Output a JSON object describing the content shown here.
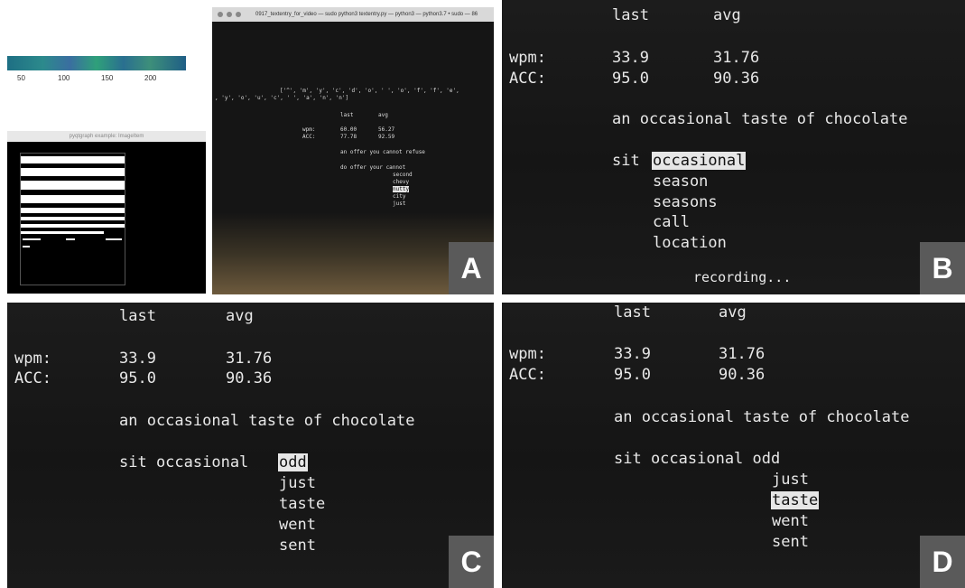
{
  "panel_a": {
    "strip_ticks": [
      "50",
      "100",
      "150",
      "200"
    ],
    "pygraph_title": "pyqtgraph example: ImageItem",
    "terminal_title": "0917_textentry_for_video — sudo python3 textentry.py — python3 — python3.7 • sudo — 86",
    "char_list_line1": "['^', 'm', 'y', 'c', 'd', 'o', ' ', 'o', 'f', 'f', 'e',",
    "char_list_line2": ", 'y', 'o', 'u', 'c', ' ', 'a', 'n', 'n']",
    "col_last": "last",
    "col_avg": "avg",
    "wpm_label": "wpm:",
    "wpm_last": "60.00",
    "wpm_avg": "56.27",
    "acc_label": "ACC:",
    "acc_last": "77.78",
    "acc_avg": "92.59",
    "target": "an offer you cannot refuse",
    "typed": "do offer your cannot",
    "suggestions": [
      "second",
      "chevy",
      "nutty",
      "city",
      "just"
    ],
    "highlighted_index": 2,
    "badge": "A"
  },
  "panel_b": {
    "col_last": "last",
    "col_avg": "avg",
    "wpm_label": "wpm:",
    "wpm_last": "33.9",
    "wpm_avg": "31.76",
    "acc_label": "ACC:",
    "acc_last": "95.0",
    "acc_avg": "90.36",
    "target": "an occasional taste of chocolate",
    "typed_prefix": "sit",
    "highlighted": "occasional",
    "suggestions": [
      "season",
      "seasons",
      "call",
      "location"
    ],
    "status": "recording...",
    "badge": "B"
  },
  "panel_c": {
    "col_last": "last",
    "col_avg": "avg",
    "wpm_label": "wpm:",
    "wpm_last": "33.9",
    "wpm_avg": "31.76",
    "acc_label": "ACC:",
    "acc_last": "95.0",
    "acc_avg": "90.36",
    "target": "an occasional taste of chocolate",
    "typed_prefix": "sit occasional",
    "highlighted": "odd",
    "suggestions": [
      "just",
      "taste",
      "went",
      "sent"
    ],
    "badge": "C"
  },
  "panel_d": {
    "col_last": "last",
    "col_avg": "avg",
    "wpm_label": "wpm:",
    "wpm_last": "33.9",
    "wpm_avg": "31.76",
    "acc_label": "ACC:",
    "acc_last": "95.0",
    "acc_avg": "90.36",
    "target": "an occasional taste of chocolate",
    "typed_prefix": "sit occasional odd",
    "suggestion_1": "just",
    "highlighted": "taste",
    "suggestion_3": "went",
    "suggestion_4": "sent",
    "badge": "D"
  }
}
